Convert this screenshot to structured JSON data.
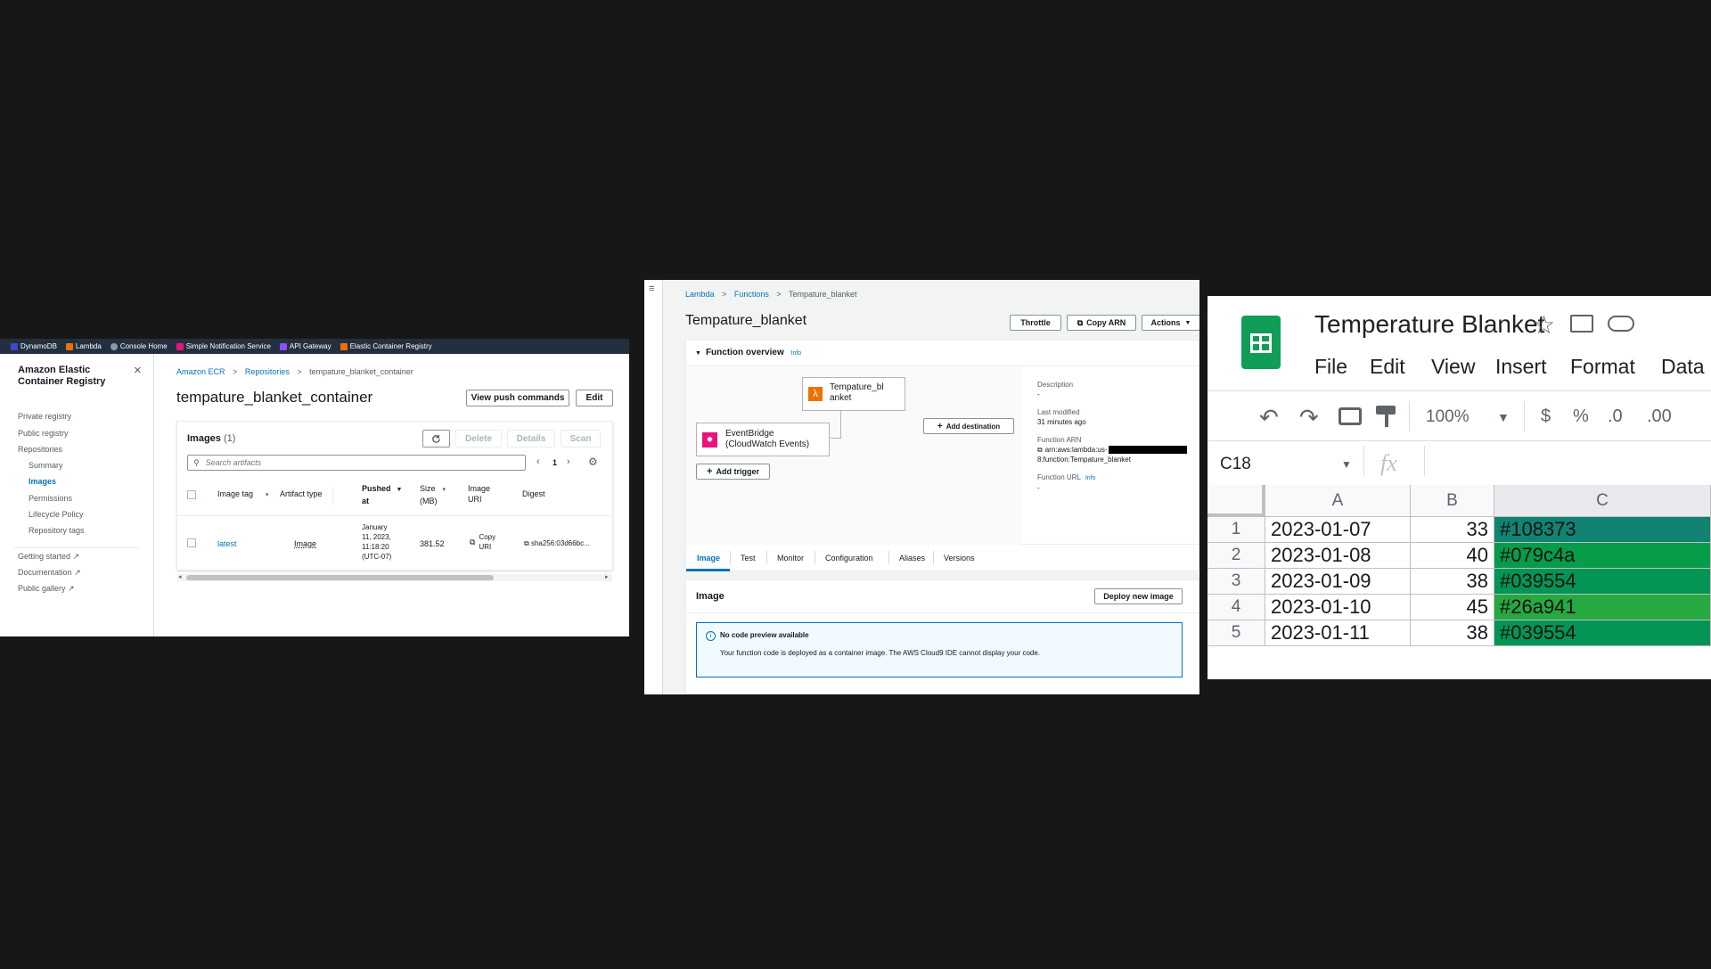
{
  "ecr": {
    "favorites": [
      {
        "label": "DynamoDB",
        "color": "#3b48cc"
      },
      {
        "label": "Lambda",
        "color": "#ed7100"
      },
      {
        "label": "Console Home",
        "color": "#8d99a8"
      },
      {
        "label": "Simple Notification Service",
        "color": "#e7157b"
      },
      {
        "label": "API Gateway",
        "color": "#8c4fff"
      },
      {
        "label": "Elastic Container Registry",
        "color": "#ed7100"
      }
    ],
    "service_title_line1": "Amazon Elastic",
    "service_title_line2": "Container Registry",
    "close_icon": "×",
    "nav": {
      "private_registry": "Private registry",
      "public_registry": "Public registry",
      "repositories": "Repositories",
      "summary": "Summary",
      "images": "Images",
      "permissions": "Permissions",
      "lifecycle_policy": "Lifecycle Policy",
      "repository_tags": "Repository tags",
      "getting_started": "Getting started",
      "documentation": "Documentation",
      "public_gallery": "Public gallery"
    },
    "breadcrumb": {
      "c1": "Amazon ECR",
      "c2": "Repositories",
      "c3": "tempature_blanket_container",
      "sep": ">"
    },
    "title": "tempature_blanket_container",
    "buttons": {
      "view_push": "View push commands",
      "edit": "Edit",
      "delete": "Delete",
      "details": "Details",
      "scan": "Scan"
    },
    "images_heading": "Images",
    "images_count": "(1)",
    "search_placeholder": "Search artifacts",
    "page_number": "1",
    "columns": {
      "tag": "Image tag",
      "type": "Artifact type",
      "pushed1": "Pushed",
      "pushed2": "at",
      "size1": "Size",
      "size2": "(MB)",
      "uri1": "Image",
      "uri2": "URI",
      "digest": "Digest"
    },
    "row": {
      "tag": "latest",
      "type": "Image",
      "pushed": [
        "January",
        "11, 2023,",
        "11:18:20",
        "(UTC-07)"
      ],
      "size": "381.52",
      "uri1": "Copy",
      "uri2": "URI",
      "digest": "sha256:03d66bc..."
    }
  },
  "lambda": {
    "breadcrumb": {
      "c1": "Lambda",
      "c2": "Functions",
      "c3": "Tempature_blanket",
      "sep": ">"
    },
    "title": "Tempature_blanket",
    "buttons": {
      "throttle": "Throttle",
      "copy_arn": "Copy ARN",
      "actions": "Actions",
      "add_destination": "Add destination",
      "add_trigger": "Add trigger",
      "deploy": "Deploy new image"
    },
    "overview_heading": "Function overview",
    "info": "Info",
    "function_box_line1": "Tempature_bl",
    "function_box_line2": "anket",
    "trigger_line1": "EventBridge",
    "trigger_line2": "(CloudWatch Events)",
    "description_label": "Description",
    "description_value": "-",
    "modified_label": "Last modified",
    "modified_value": "31 minutes ago",
    "arn_label": "Function ARN",
    "arn_line1": "arn:aws:lambda:us-",
    "arn_line2": "8:function:Tempature_blanket",
    "url_label": "Function URL",
    "url_info": "Info",
    "url_value": "-",
    "tabs": [
      "Image",
      "Test",
      "Monitor",
      "Configuration",
      "Aliases",
      "Versions"
    ],
    "image_heading": "Image",
    "alert_title": "No code preview available",
    "alert_body": "Your function code is deployed as a container image. The AWS Cloud9 IDE cannot display your code."
  },
  "sheet": {
    "title": "Temperature Blanket",
    "menu": [
      "File",
      "Edit",
      "View",
      "Insert",
      "Format",
      "Data"
    ],
    "zoom": "100%",
    "currency": "$",
    "percent": "%",
    "dec_less": ".0",
    "dec_more": ".00",
    "name_box": "C18",
    "fx": "fx",
    "col_headers": [
      "A",
      "B",
      "C"
    ],
    "rows": [
      {
        "n": "1",
        "a": "2023-01-07",
        "b": "33",
        "c": "#108373"
      },
      {
        "n": "2",
        "a": "2023-01-08",
        "b": "40",
        "c": "#079c4a"
      },
      {
        "n": "3",
        "a": "2023-01-09",
        "b": "38",
        "c": "#039554"
      },
      {
        "n": "4",
        "a": "2023-01-10",
        "b": "45",
        "c": "#26a941"
      },
      {
        "n": "5",
        "a": "2023-01-11",
        "b": "38",
        "c": "#039554"
      }
    ],
    "brand_color": "#0f9d58"
  }
}
